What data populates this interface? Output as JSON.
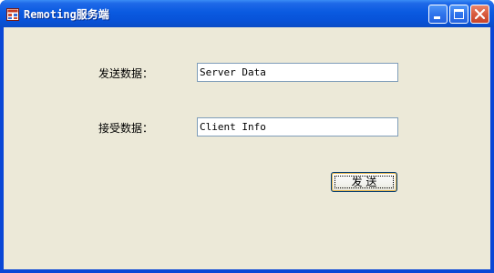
{
  "window": {
    "title": "Remoting服务端",
    "icon": "application-icon",
    "controls": {
      "minimize": "minimize-icon",
      "maximize": "maximize-icon",
      "close": "close-icon"
    }
  },
  "form": {
    "send_label": "发送数据：",
    "send_value": "Server Data",
    "receive_label": "接受数据：",
    "receive_value": "Client Info",
    "send_button": "发 送"
  },
  "colors": {
    "titlebar": "#0a5ae0",
    "client_bg": "#ece9d8",
    "textbox_border": "#7f9db9",
    "close_button": "#d85b3d"
  }
}
